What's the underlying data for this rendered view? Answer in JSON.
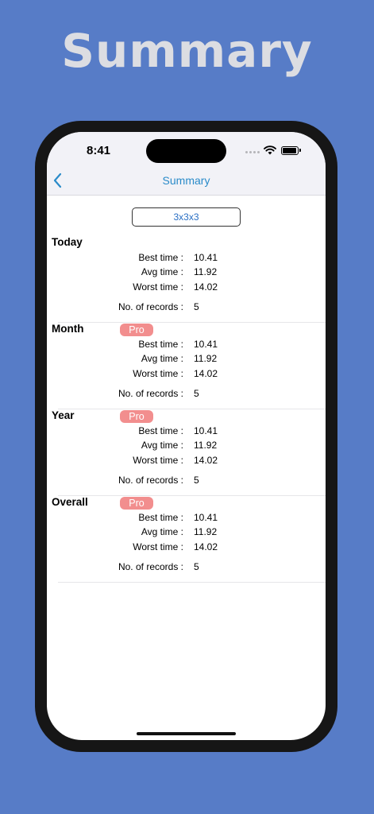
{
  "promo": {
    "title": "Summary"
  },
  "status_bar": {
    "time": "8:41"
  },
  "nav": {
    "title": "Summary"
  },
  "puzzle_selector": {
    "value": "3x3x3"
  },
  "labels": {
    "best": "Best time :",
    "avg": "Avg time :",
    "worst": "Worst time :",
    "records": "No. of records :"
  },
  "sections": [
    {
      "title": "Today",
      "pro": "",
      "best": "10.41",
      "avg": "11.92",
      "worst": "14.02",
      "records": "5"
    },
    {
      "title": "Month",
      "pro": "Pro",
      "best": "10.41",
      "avg": "11.92",
      "worst": "14.02",
      "records": "5"
    },
    {
      "title": "Year",
      "pro": "Pro",
      "best": "10.41",
      "avg": "11.92",
      "worst": "14.02",
      "records": "5"
    },
    {
      "title": "Overall",
      "pro": "Pro",
      "best": "10.41",
      "avg": "11.92",
      "worst": "14.02",
      "records": "5"
    }
  ],
  "colors": {
    "background": "#577cc7",
    "accent": "#2a8bc9",
    "pro_badge": "#f28e8e"
  }
}
